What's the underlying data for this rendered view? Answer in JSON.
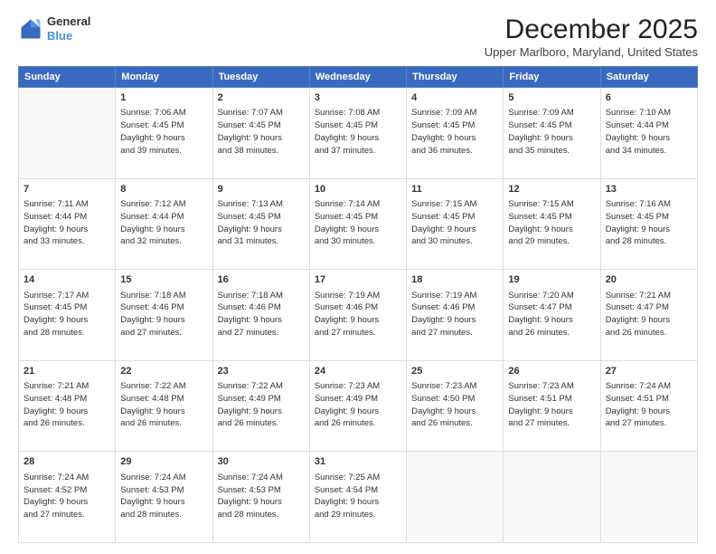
{
  "logo": {
    "line1": "General",
    "line2": "Blue"
  },
  "title": "December 2025",
  "subtitle": "Upper Marlboro, Maryland, United States",
  "headers": [
    "Sunday",
    "Monday",
    "Tuesday",
    "Wednesday",
    "Thursday",
    "Friday",
    "Saturday"
  ],
  "weeks": [
    [
      {
        "day": "",
        "info": ""
      },
      {
        "day": "1",
        "info": "Sunrise: 7:06 AM\nSunset: 4:45 PM\nDaylight: 9 hours\nand 39 minutes."
      },
      {
        "day": "2",
        "info": "Sunrise: 7:07 AM\nSunset: 4:45 PM\nDaylight: 9 hours\nand 38 minutes."
      },
      {
        "day": "3",
        "info": "Sunrise: 7:08 AM\nSunset: 4:45 PM\nDaylight: 9 hours\nand 37 minutes."
      },
      {
        "day": "4",
        "info": "Sunrise: 7:09 AM\nSunset: 4:45 PM\nDaylight: 9 hours\nand 36 minutes."
      },
      {
        "day": "5",
        "info": "Sunrise: 7:09 AM\nSunset: 4:45 PM\nDaylight: 9 hours\nand 35 minutes."
      },
      {
        "day": "6",
        "info": "Sunrise: 7:10 AM\nSunset: 4:44 PM\nDaylight: 9 hours\nand 34 minutes."
      }
    ],
    [
      {
        "day": "7",
        "info": "Sunrise: 7:11 AM\nSunset: 4:44 PM\nDaylight: 9 hours\nand 33 minutes."
      },
      {
        "day": "8",
        "info": "Sunrise: 7:12 AM\nSunset: 4:44 PM\nDaylight: 9 hours\nand 32 minutes."
      },
      {
        "day": "9",
        "info": "Sunrise: 7:13 AM\nSunset: 4:45 PM\nDaylight: 9 hours\nand 31 minutes."
      },
      {
        "day": "10",
        "info": "Sunrise: 7:14 AM\nSunset: 4:45 PM\nDaylight: 9 hours\nand 30 minutes."
      },
      {
        "day": "11",
        "info": "Sunrise: 7:15 AM\nSunset: 4:45 PM\nDaylight: 9 hours\nand 30 minutes."
      },
      {
        "day": "12",
        "info": "Sunrise: 7:15 AM\nSunset: 4:45 PM\nDaylight: 9 hours\nand 29 minutes."
      },
      {
        "day": "13",
        "info": "Sunrise: 7:16 AM\nSunset: 4:45 PM\nDaylight: 9 hours\nand 28 minutes."
      }
    ],
    [
      {
        "day": "14",
        "info": "Sunrise: 7:17 AM\nSunset: 4:45 PM\nDaylight: 9 hours\nand 28 minutes."
      },
      {
        "day": "15",
        "info": "Sunrise: 7:18 AM\nSunset: 4:46 PM\nDaylight: 9 hours\nand 27 minutes."
      },
      {
        "day": "16",
        "info": "Sunrise: 7:18 AM\nSunset: 4:46 PM\nDaylight: 9 hours\nand 27 minutes."
      },
      {
        "day": "17",
        "info": "Sunrise: 7:19 AM\nSunset: 4:46 PM\nDaylight: 9 hours\nand 27 minutes."
      },
      {
        "day": "18",
        "info": "Sunrise: 7:19 AM\nSunset: 4:46 PM\nDaylight: 9 hours\nand 27 minutes."
      },
      {
        "day": "19",
        "info": "Sunrise: 7:20 AM\nSunset: 4:47 PM\nDaylight: 9 hours\nand 26 minutes."
      },
      {
        "day": "20",
        "info": "Sunrise: 7:21 AM\nSunset: 4:47 PM\nDaylight: 9 hours\nand 26 minutes."
      }
    ],
    [
      {
        "day": "21",
        "info": "Sunrise: 7:21 AM\nSunset: 4:48 PM\nDaylight: 9 hours\nand 26 minutes."
      },
      {
        "day": "22",
        "info": "Sunrise: 7:22 AM\nSunset: 4:48 PM\nDaylight: 9 hours\nand 26 minutes."
      },
      {
        "day": "23",
        "info": "Sunrise: 7:22 AM\nSunset: 4:49 PM\nDaylight: 9 hours\nand 26 minutes."
      },
      {
        "day": "24",
        "info": "Sunrise: 7:23 AM\nSunset: 4:49 PM\nDaylight: 9 hours\nand 26 minutes."
      },
      {
        "day": "25",
        "info": "Sunrise: 7:23 AM\nSunset: 4:50 PM\nDaylight: 9 hours\nand 26 minutes."
      },
      {
        "day": "26",
        "info": "Sunrise: 7:23 AM\nSunset: 4:51 PM\nDaylight: 9 hours\nand 27 minutes."
      },
      {
        "day": "27",
        "info": "Sunrise: 7:24 AM\nSunset: 4:51 PM\nDaylight: 9 hours\nand 27 minutes."
      }
    ],
    [
      {
        "day": "28",
        "info": "Sunrise: 7:24 AM\nSunset: 4:52 PM\nDaylight: 9 hours\nand 27 minutes."
      },
      {
        "day": "29",
        "info": "Sunrise: 7:24 AM\nSunset: 4:53 PM\nDaylight: 9 hours\nand 28 minutes."
      },
      {
        "day": "30",
        "info": "Sunrise: 7:24 AM\nSunset: 4:53 PM\nDaylight: 9 hours\nand 28 minutes."
      },
      {
        "day": "31",
        "info": "Sunrise: 7:25 AM\nSunset: 4:54 PM\nDaylight: 9 hours\nand 29 minutes."
      },
      {
        "day": "",
        "info": ""
      },
      {
        "day": "",
        "info": ""
      },
      {
        "day": "",
        "info": ""
      }
    ]
  ]
}
